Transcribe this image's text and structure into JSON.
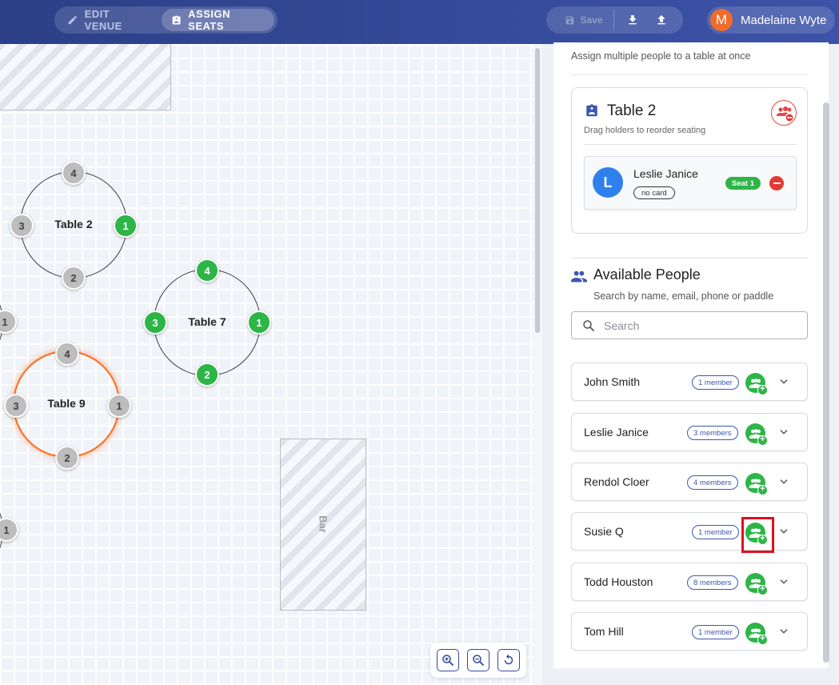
{
  "topbar": {
    "edit_label": "EDIT VENUE",
    "assign_label": "ASSIGN SEATS",
    "save_label": "Save",
    "user_initial": "M",
    "user_name": "Madelaine Wyte"
  },
  "canvas": {
    "tables": [
      {
        "name": "Table 2",
        "seats": [
          {
            "n": "4",
            "state": "empty"
          },
          {
            "n": "3",
            "state": "empty"
          },
          {
            "n": "1",
            "state": "taken"
          },
          {
            "n": "2",
            "state": "empty"
          }
        ]
      },
      {
        "name": "Table 7",
        "seats": [
          {
            "n": "4",
            "state": "taken"
          },
          {
            "n": "3",
            "state": "taken"
          },
          {
            "n": "1",
            "state": "taken"
          },
          {
            "n": "2",
            "state": "taken"
          }
        ]
      },
      {
        "name": "Table 9",
        "selected": true,
        "seats": [
          {
            "n": "4",
            "state": "empty"
          },
          {
            "n": "3",
            "state": "empty"
          },
          {
            "n": "1",
            "state": "empty"
          },
          {
            "n": "2",
            "state": "empty"
          }
        ]
      }
    ],
    "partial_seats": [
      "1",
      "1",
      "1"
    ],
    "bar_label": "Bar"
  },
  "panel": {
    "hint": "Assign multiple people to a table at once",
    "selected_table": {
      "title": "Table 2",
      "subtitle": "Drag holders to reorder seating",
      "holder": {
        "initial": "L",
        "name": "Leslie Janice",
        "card": "no card",
        "seat": "Seat 1"
      }
    },
    "available": {
      "title": "Available People",
      "subtitle": "Search by name, email, phone or paddle",
      "search_placeholder": "Search",
      "groups": [
        {
          "name": "John Smith",
          "count": "1 member"
        },
        {
          "name": "Leslie Janice",
          "count": "3 members"
        },
        {
          "name": "Rendol Cloer",
          "count": "4 members"
        },
        {
          "name": "Susie Q",
          "count": "1 member"
        },
        {
          "name": "Todd Houston",
          "count": "8 members"
        },
        {
          "name": "Tom Hill",
          "count": "1 member"
        }
      ]
    }
  },
  "colors": {
    "brand": "#33489a",
    "seat_taken": "#2db548",
    "selected_table": "#ff6b1a",
    "danger": "#e53935"
  }
}
